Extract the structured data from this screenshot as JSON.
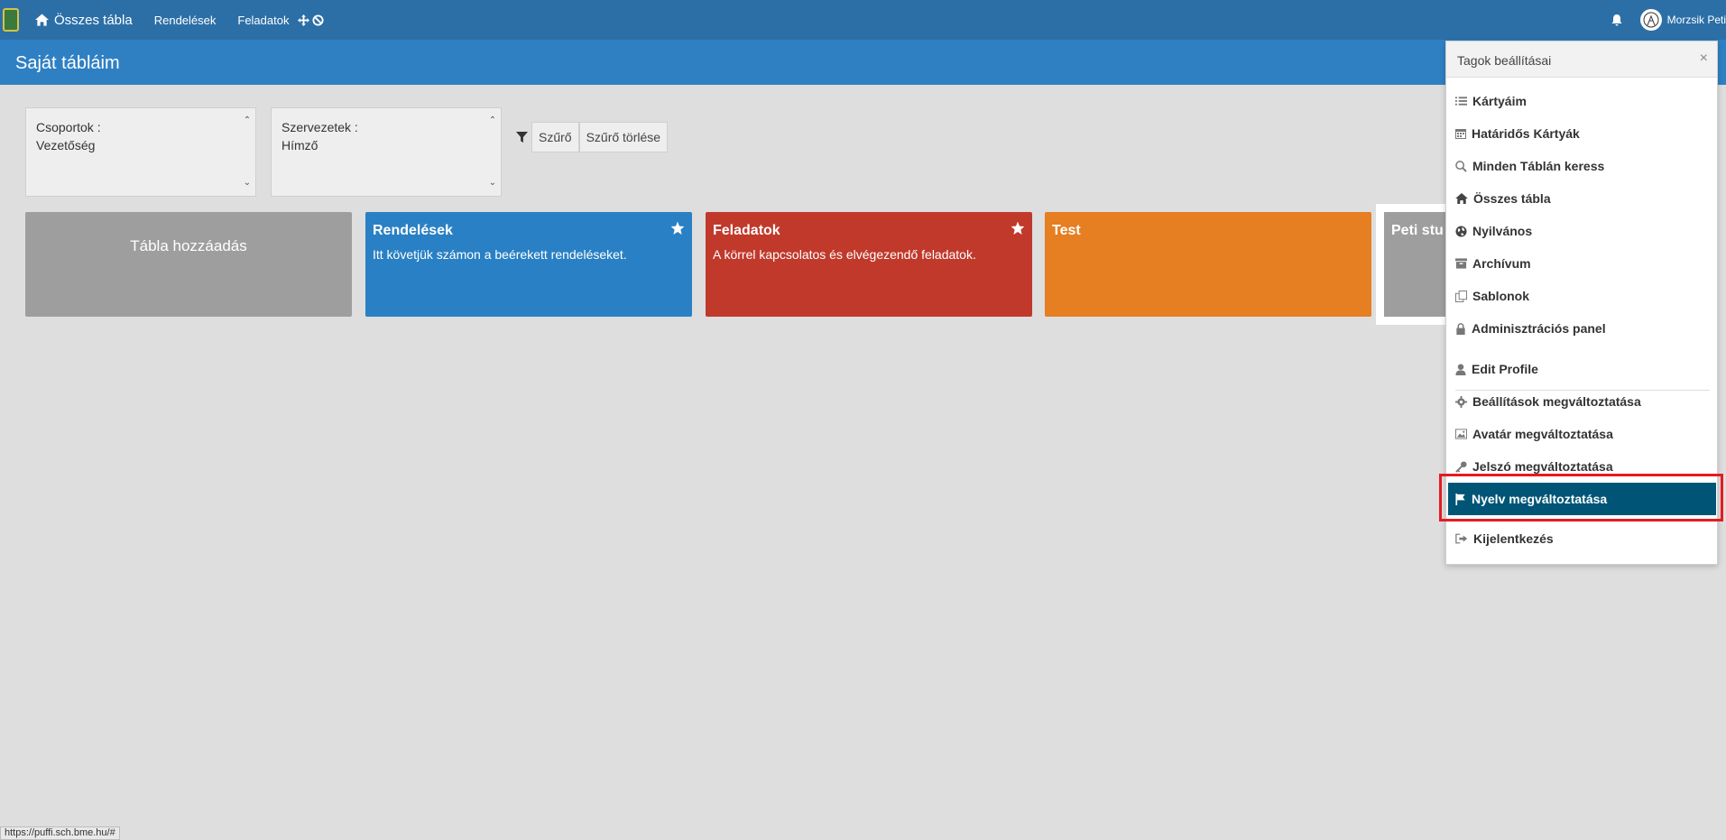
{
  "navbar": {
    "home_label": "Összes tábla",
    "links": [
      "Rendelések",
      "Feladatok"
    ],
    "username": "Morzsik Peti"
  },
  "header": {
    "title": "Saját tábláim"
  },
  "filters": {
    "groups_label": "Csoportok :",
    "groups_value": "Vezetőség",
    "orgs_label": "Szervezetek :",
    "orgs_value": "Hímző",
    "filter_button": "Szűrő",
    "clear_button": "Szűrő törlése"
  },
  "boards": {
    "add_label": "Tábla hozzáadás",
    "items": [
      {
        "title": "Rendelések",
        "description": "Itt követjük számon a beérekett rendeléseket.",
        "color": "#2980c4",
        "starred": true
      },
      {
        "title": "Feladatok",
        "description": "A körrel kapcsolatos és elvégezendő feladatok.",
        "color": "#c0392b",
        "starred": true
      },
      {
        "title": "Test",
        "description": "",
        "color": "#e67e22",
        "starred": false
      },
      {
        "title": "Peti stu",
        "description": "",
        "color": "#9e9e9e",
        "starred": false
      }
    ]
  },
  "panel": {
    "title": "Tagok beállításai",
    "close_icon": "close-icon",
    "items": [
      {
        "label": "Kártyáim",
        "icon": "list-icon"
      },
      {
        "label": "Határidős Kártyák",
        "icon": "calendar-icon"
      },
      {
        "label": "Minden Táblán keress",
        "icon": "search-icon"
      },
      {
        "label": "Összes tábla",
        "icon": "home-icon"
      },
      {
        "label": "Nyilvános",
        "icon": "globe-icon"
      },
      {
        "label": "Archívum",
        "icon": "archive-icon"
      },
      {
        "label": "Sablonok",
        "icon": "copy-icon"
      },
      {
        "label": "Adminisztrációs panel",
        "icon": "lock-icon"
      },
      {
        "label": "Edit Profile",
        "icon": "user-icon"
      },
      {
        "label": "Beállítások megváltoztatása",
        "icon": "gear-icon"
      },
      {
        "label": "Avatár megváltoztatása",
        "icon": "image-icon"
      },
      {
        "label": "Jelszó megváltoztatása",
        "icon": "key-icon"
      },
      {
        "label": "Nyelv megváltoztatása",
        "icon": "flag-icon",
        "active": true
      },
      {
        "label": "Kijelentkezés",
        "icon": "logout-icon"
      }
    ],
    "active_color": "#005577",
    "highlight_color": "#e41b23"
  },
  "statusbar": {
    "url": "https://puffi.sch.bme.hu/#"
  }
}
